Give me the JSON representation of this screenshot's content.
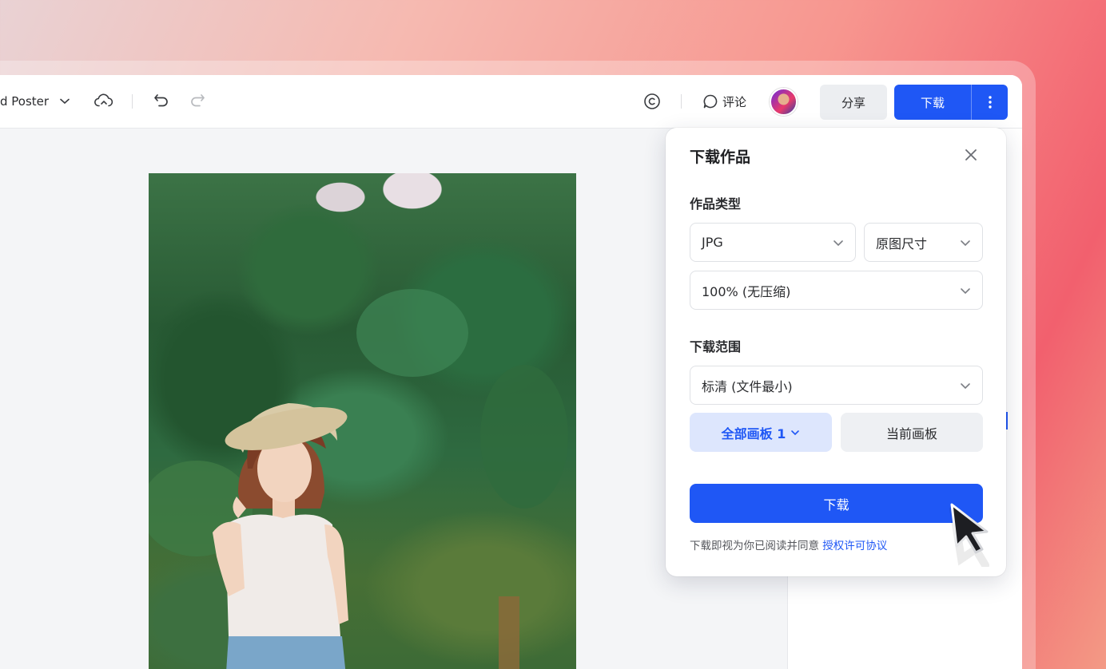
{
  "header": {
    "doc_title": "d Poster",
    "comment_label": "评论",
    "share_label": "分享",
    "download_label": "下载"
  },
  "icons": {
    "title_dropdown": "chevron-down-icon",
    "cloud": "cloud-sync-icon",
    "undo": "undo-icon",
    "redo": "redo-icon",
    "copyright": "copyright-icon",
    "comment": "comment-icon",
    "more": "more-vertical-icon",
    "close": "close-icon",
    "cursor": "mouse-pointer-icon"
  },
  "popover": {
    "title": "下载作品",
    "type_section": "作品类型",
    "format": "JPG",
    "size": "原图尺寸",
    "quality": "100% (无压缩)",
    "range_section": "下载范围",
    "resolution": "标清 (文件最小)",
    "all_boards": "全部画板 1",
    "current_board": "当前画板",
    "download_button": "下载",
    "agreement_text": "下载即视为你已阅读并同意",
    "agreement_link": "授权许可协议"
  },
  "colors": {
    "primary": "#1f57f5",
    "active_segment_bg": "#dde6fd"
  }
}
